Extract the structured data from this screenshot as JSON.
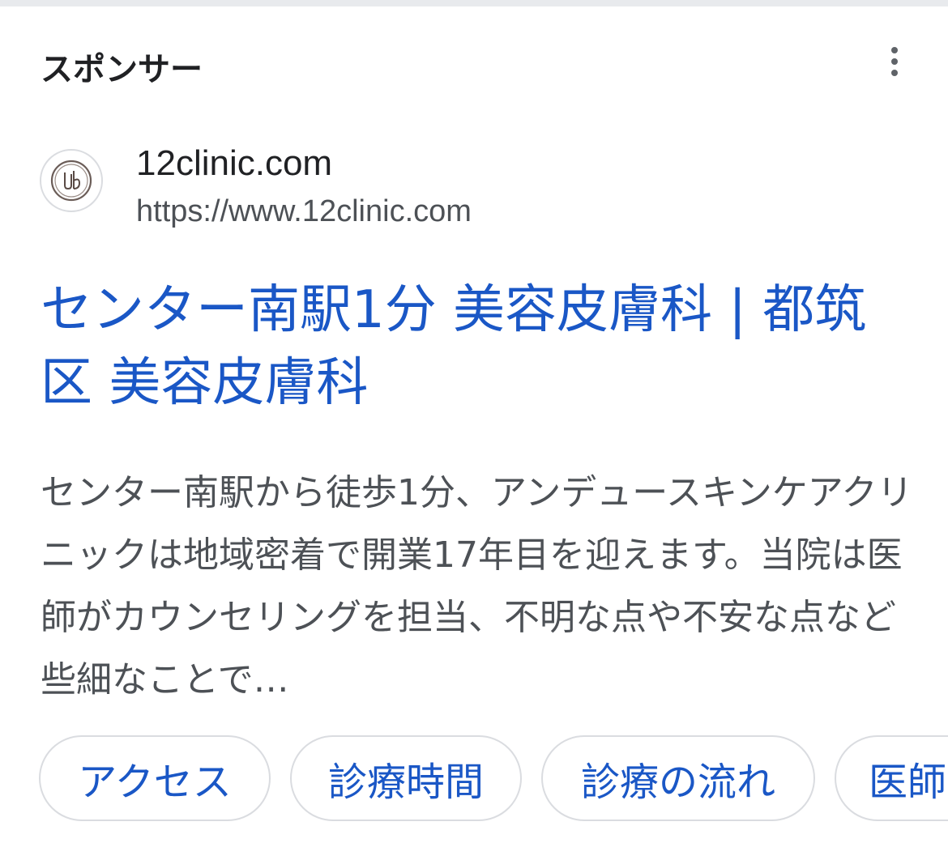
{
  "header": {
    "sponsor_label": "スポンサー",
    "more_icon": "more-vert-icon"
  },
  "site": {
    "favicon": "clinic-logo-icon",
    "name": "12clinic.com",
    "url": "https://www.12clinic.com"
  },
  "ad": {
    "title": "センター南駅1分 美容皮膚科 | 都筑区 美容皮膚科",
    "description": "センター南駅から徒歩1分、アンデュースキンケアクリニックは地域密着で開業17年目を迎えます。当院は医師がカウンセリングを担当、不明な点や不安な点など些細なことで…"
  },
  "sitelinks": [
    {
      "label": "アクセス"
    },
    {
      "label": "診療時間"
    },
    {
      "label": "診療の流れ"
    },
    {
      "label": "医師"
    }
  ],
  "colors": {
    "link_blue": "#1a57c6",
    "text_dark": "#202124",
    "text_gray": "#4d5156",
    "border": "#dadce0"
  }
}
